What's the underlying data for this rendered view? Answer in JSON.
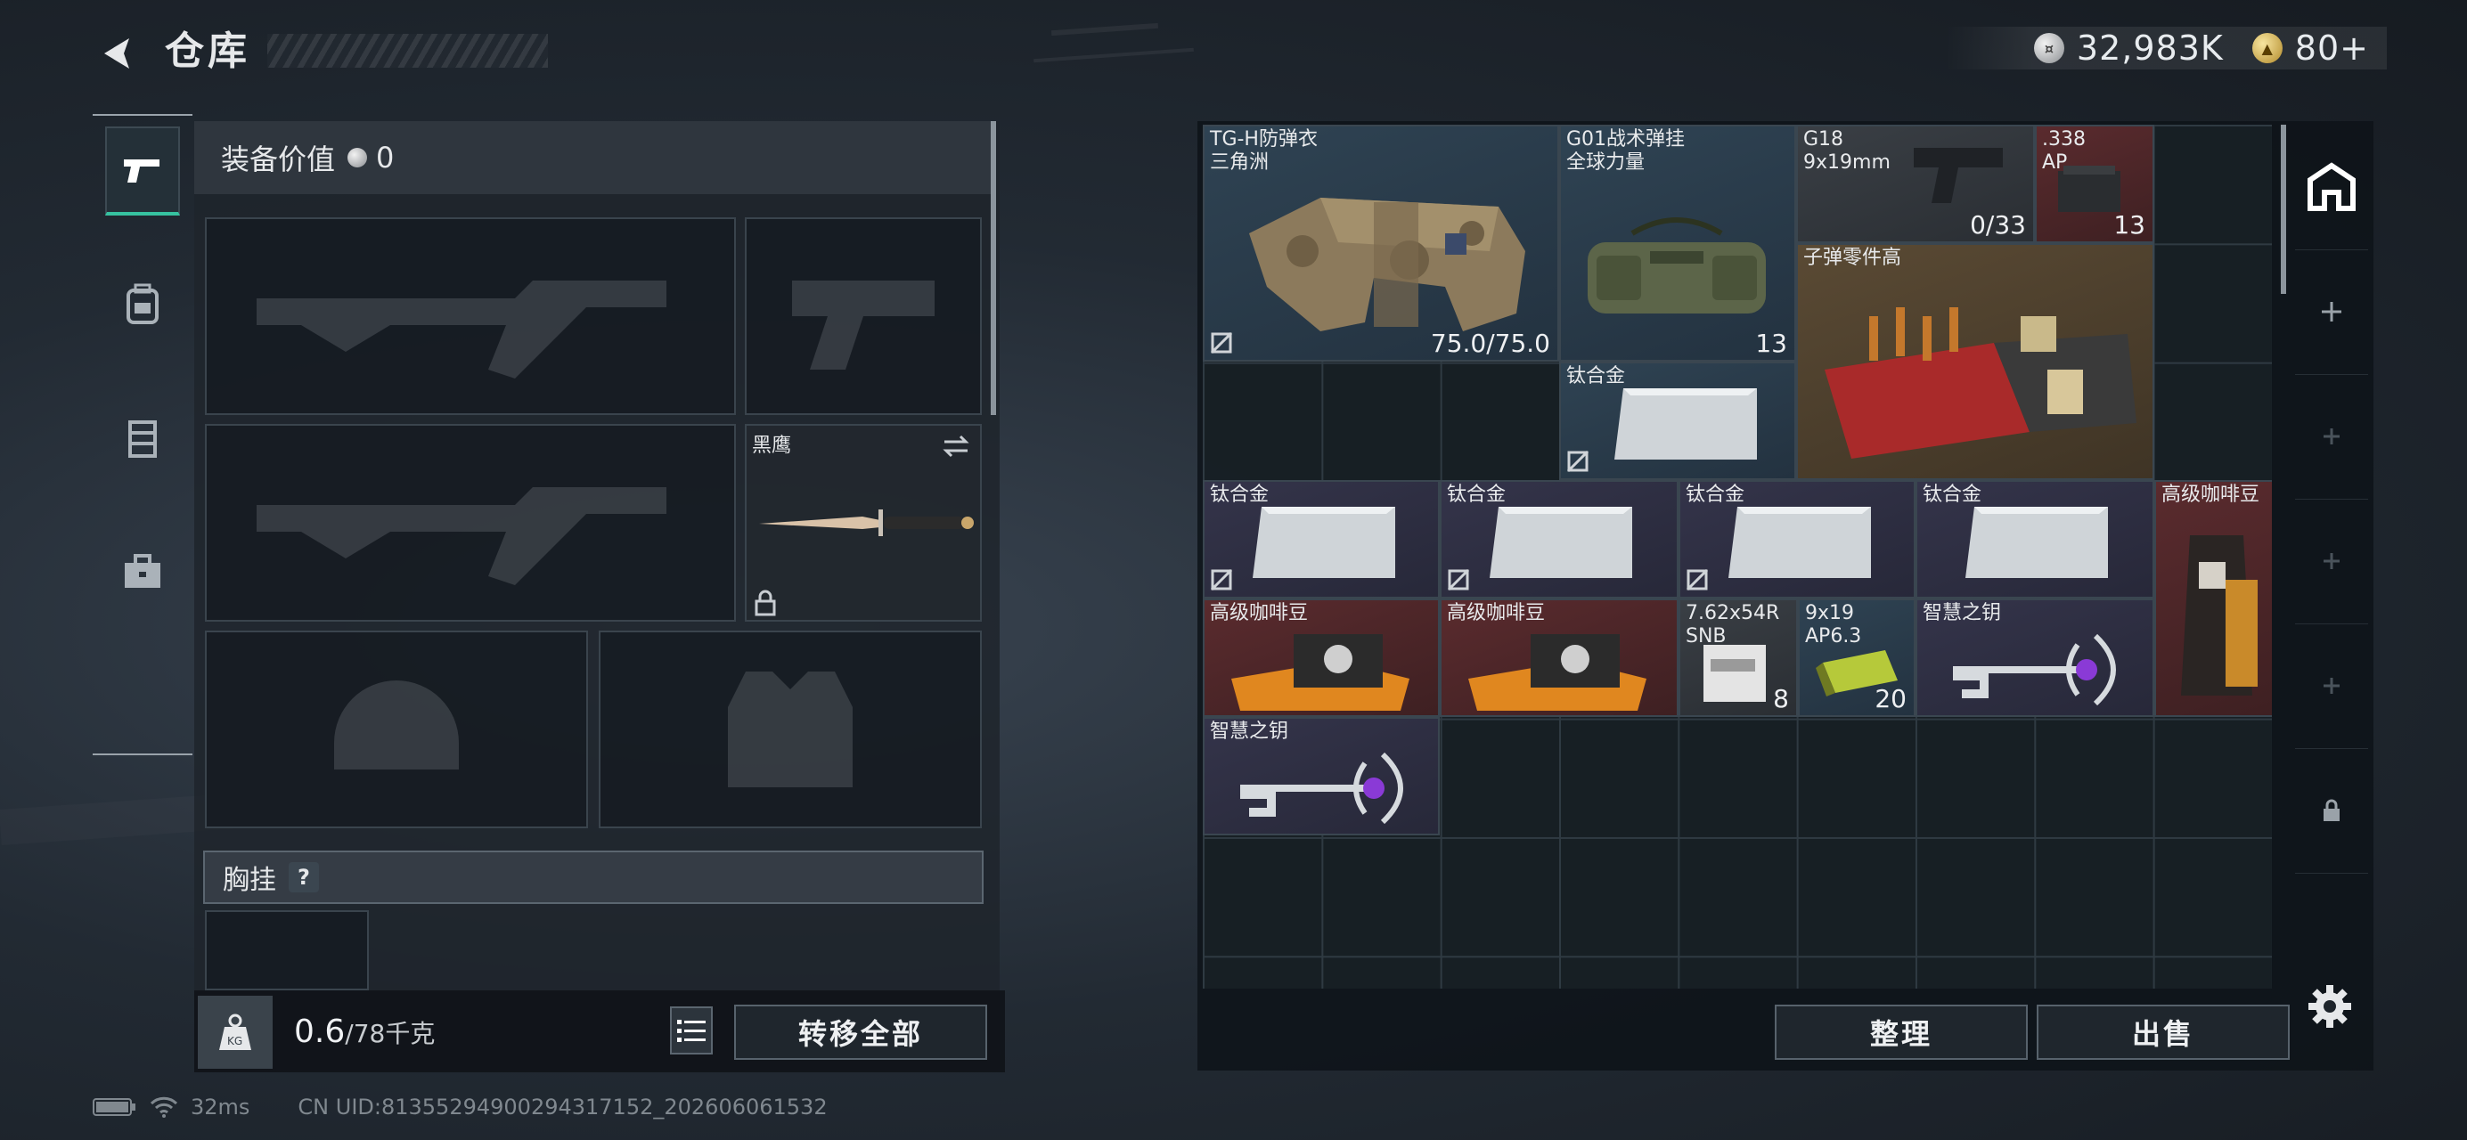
{
  "header": {
    "title": "仓库"
  },
  "currency": {
    "silver": "32,983K",
    "gold": "80+"
  },
  "tabs": [
    "weapon-tab",
    "backpack-tab",
    "vest-tab",
    "case-tab"
  ],
  "equipment": {
    "value_label": "装备价值",
    "value": "0",
    "knife_name": "黑鹰",
    "chest_label": "胸挂",
    "chest_help": "?"
  },
  "weight": {
    "current": "0.6",
    "max": "/78千克"
  },
  "buttons": {
    "transfer_all": "转移全部",
    "organize": "整理",
    "sell": "出售"
  },
  "status": {
    "ping": "32ms",
    "uid": "CN UID:813552949002943171​52_202606061532"
  },
  "stash": {
    "armor": {
      "name": "TG-H防弹衣\n三角洲",
      "durability": "75.0/75.0"
    },
    "bag": {
      "name": "G01战术弹挂\n全球力量",
      "count": "13"
    },
    "pistol": {
      "name": "G18\n9x19mm",
      "ammo": "0/33"
    },
    "ammo338": {
      "name": ".338\nAP",
      "count": "13"
    },
    "parts": {
      "name": "子弹零件高"
    },
    "titanium": "钛合金",
    "coffee": "高级咖啡豆",
    "ammo762": {
      "name": "7.62x54R\nSNB",
      "count": "8"
    },
    "ammo919": {
      "name": "9x19\nAP6.3",
      "count": "20"
    },
    "key": "智慧之钥"
  }
}
